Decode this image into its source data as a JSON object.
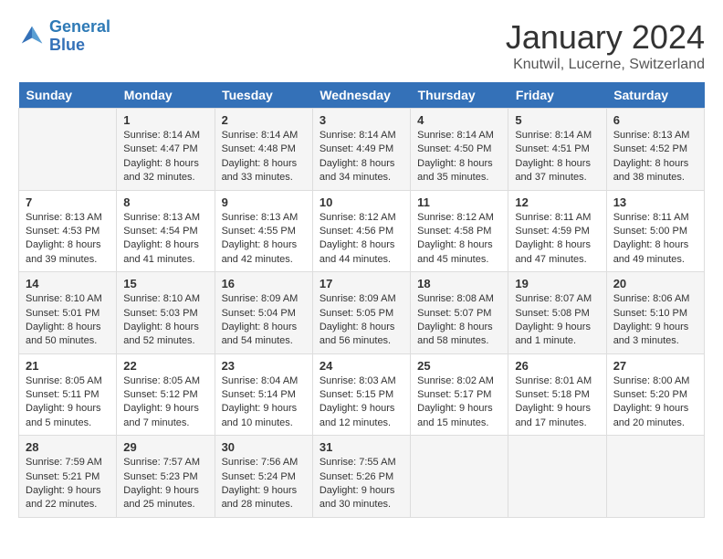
{
  "header": {
    "logo_line1": "General",
    "logo_line2": "Blue",
    "month_title": "January 2024",
    "location": "Knutwil, Lucerne, Switzerland"
  },
  "days_of_week": [
    "Sunday",
    "Monday",
    "Tuesday",
    "Wednesday",
    "Thursday",
    "Friday",
    "Saturday"
  ],
  "weeks": [
    [
      {
        "num": "",
        "sunrise": "",
        "sunset": "",
        "daylight": ""
      },
      {
        "num": "1",
        "sunrise": "Sunrise: 8:14 AM",
        "sunset": "Sunset: 4:47 PM",
        "daylight": "Daylight: 8 hours and 32 minutes."
      },
      {
        "num": "2",
        "sunrise": "Sunrise: 8:14 AM",
        "sunset": "Sunset: 4:48 PM",
        "daylight": "Daylight: 8 hours and 33 minutes."
      },
      {
        "num": "3",
        "sunrise": "Sunrise: 8:14 AM",
        "sunset": "Sunset: 4:49 PM",
        "daylight": "Daylight: 8 hours and 34 minutes."
      },
      {
        "num": "4",
        "sunrise": "Sunrise: 8:14 AM",
        "sunset": "Sunset: 4:50 PM",
        "daylight": "Daylight: 8 hours and 35 minutes."
      },
      {
        "num": "5",
        "sunrise": "Sunrise: 8:14 AM",
        "sunset": "Sunset: 4:51 PM",
        "daylight": "Daylight: 8 hours and 37 minutes."
      },
      {
        "num": "6",
        "sunrise": "Sunrise: 8:13 AM",
        "sunset": "Sunset: 4:52 PM",
        "daylight": "Daylight: 8 hours and 38 minutes."
      }
    ],
    [
      {
        "num": "7",
        "sunrise": "Sunrise: 8:13 AM",
        "sunset": "Sunset: 4:53 PM",
        "daylight": "Daylight: 8 hours and 39 minutes."
      },
      {
        "num": "8",
        "sunrise": "Sunrise: 8:13 AM",
        "sunset": "Sunset: 4:54 PM",
        "daylight": "Daylight: 8 hours and 41 minutes."
      },
      {
        "num": "9",
        "sunrise": "Sunrise: 8:13 AM",
        "sunset": "Sunset: 4:55 PM",
        "daylight": "Daylight: 8 hours and 42 minutes."
      },
      {
        "num": "10",
        "sunrise": "Sunrise: 8:12 AM",
        "sunset": "Sunset: 4:56 PM",
        "daylight": "Daylight: 8 hours and 44 minutes."
      },
      {
        "num": "11",
        "sunrise": "Sunrise: 8:12 AM",
        "sunset": "Sunset: 4:58 PM",
        "daylight": "Daylight: 8 hours and 45 minutes."
      },
      {
        "num": "12",
        "sunrise": "Sunrise: 8:11 AM",
        "sunset": "Sunset: 4:59 PM",
        "daylight": "Daylight: 8 hours and 47 minutes."
      },
      {
        "num": "13",
        "sunrise": "Sunrise: 8:11 AM",
        "sunset": "Sunset: 5:00 PM",
        "daylight": "Daylight: 8 hours and 49 minutes."
      }
    ],
    [
      {
        "num": "14",
        "sunrise": "Sunrise: 8:10 AM",
        "sunset": "Sunset: 5:01 PM",
        "daylight": "Daylight: 8 hours and 50 minutes."
      },
      {
        "num": "15",
        "sunrise": "Sunrise: 8:10 AM",
        "sunset": "Sunset: 5:03 PM",
        "daylight": "Daylight: 8 hours and 52 minutes."
      },
      {
        "num": "16",
        "sunrise": "Sunrise: 8:09 AM",
        "sunset": "Sunset: 5:04 PM",
        "daylight": "Daylight: 8 hours and 54 minutes."
      },
      {
        "num": "17",
        "sunrise": "Sunrise: 8:09 AM",
        "sunset": "Sunset: 5:05 PM",
        "daylight": "Daylight: 8 hours and 56 minutes."
      },
      {
        "num": "18",
        "sunrise": "Sunrise: 8:08 AM",
        "sunset": "Sunset: 5:07 PM",
        "daylight": "Daylight: 8 hours and 58 minutes."
      },
      {
        "num": "19",
        "sunrise": "Sunrise: 8:07 AM",
        "sunset": "Sunset: 5:08 PM",
        "daylight": "Daylight: 9 hours and 1 minute."
      },
      {
        "num": "20",
        "sunrise": "Sunrise: 8:06 AM",
        "sunset": "Sunset: 5:10 PM",
        "daylight": "Daylight: 9 hours and 3 minutes."
      }
    ],
    [
      {
        "num": "21",
        "sunrise": "Sunrise: 8:05 AM",
        "sunset": "Sunset: 5:11 PM",
        "daylight": "Daylight: 9 hours and 5 minutes."
      },
      {
        "num": "22",
        "sunrise": "Sunrise: 8:05 AM",
        "sunset": "Sunset: 5:12 PM",
        "daylight": "Daylight: 9 hours and 7 minutes."
      },
      {
        "num": "23",
        "sunrise": "Sunrise: 8:04 AM",
        "sunset": "Sunset: 5:14 PM",
        "daylight": "Daylight: 9 hours and 10 minutes."
      },
      {
        "num": "24",
        "sunrise": "Sunrise: 8:03 AM",
        "sunset": "Sunset: 5:15 PM",
        "daylight": "Daylight: 9 hours and 12 minutes."
      },
      {
        "num": "25",
        "sunrise": "Sunrise: 8:02 AM",
        "sunset": "Sunset: 5:17 PM",
        "daylight": "Daylight: 9 hours and 15 minutes."
      },
      {
        "num": "26",
        "sunrise": "Sunrise: 8:01 AM",
        "sunset": "Sunset: 5:18 PM",
        "daylight": "Daylight: 9 hours and 17 minutes."
      },
      {
        "num": "27",
        "sunrise": "Sunrise: 8:00 AM",
        "sunset": "Sunset: 5:20 PM",
        "daylight": "Daylight: 9 hours and 20 minutes."
      }
    ],
    [
      {
        "num": "28",
        "sunrise": "Sunrise: 7:59 AM",
        "sunset": "Sunset: 5:21 PM",
        "daylight": "Daylight: 9 hours and 22 minutes."
      },
      {
        "num": "29",
        "sunrise": "Sunrise: 7:57 AM",
        "sunset": "Sunset: 5:23 PM",
        "daylight": "Daylight: 9 hours and 25 minutes."
      },
      {
        "num": "30",
        "sunrise": "Sunrise: 7:56 AM",
        "sunset": "Sunset: 5:24 PM",
        "daylight": "Daylight: 9 hours and 28 minutes."
      },
      {
        "num": "31",
        "sunrise": "Sunrise: 7:55 AM",
        "sunset": "Sunset: 5:26 PM",
        "daylight": "Daylight: 9 hours and 30 minutes."
      },
      {
        "num": "",
        "sunrise": "",
        "sunset": "",
        "daylight": ""
      },
      {
        "num": "",
        "sunrise": "",
        "sunset": "",
        "daylight": ""
      },
      {
        "num": "",
        "sunrise": "",
        "sunset": "",
        "daylight": ""
      }
    ]
  ]
}
